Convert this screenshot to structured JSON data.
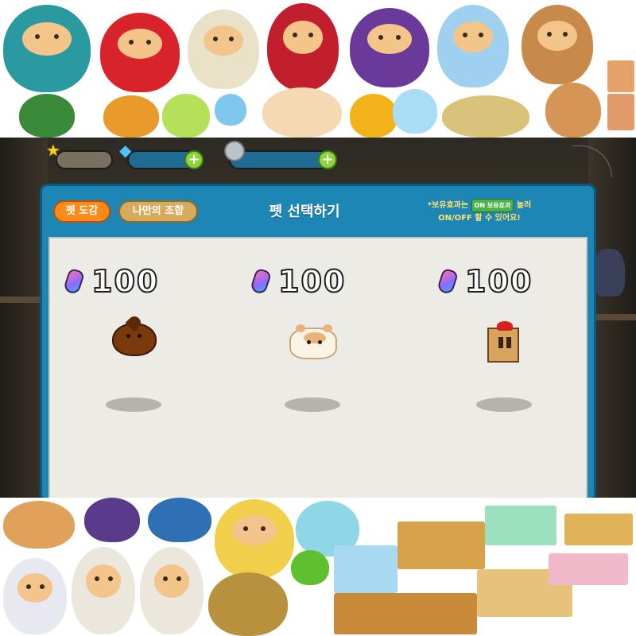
{
  "currency": {
    "star_icon": "star-icon",
    "gem_icon": "gem-icon",
    "coin_icon": "coin-icon"
  },
  "panel": {
    "tab_pet_book": "펫 도감",
    "tab_my_combo": "나만의 조합",
    "title": "펫 선택하기",
    "hint_line1_prefix": "*보유효과는",
    "hint_badge_top": "ON",
    "hint_badge": "보유효과",
    "hint_line1_suffix": "눌러",
    "hint_line2": "ON/OFF 할 수 있어요!"
  },
  "pets": [
    {
      "price": "100",
      "sprite": "chestnut-pet"
    },
    {
      "price": "100",
      "sprite": "hamster-pet"
    },
    {
      "price": "100",
      "sprite": "gift-box-pet"
    }
  ],
  "colors": {
    "panel_blue": "#1e86b4",
    "tab_orange": "#ff8a1a",
    "tab_tan": "#d7ab5e",
    "plus_green": "#8fd33b",
    "hint_yellow": "#ffe36a"
  }
}
